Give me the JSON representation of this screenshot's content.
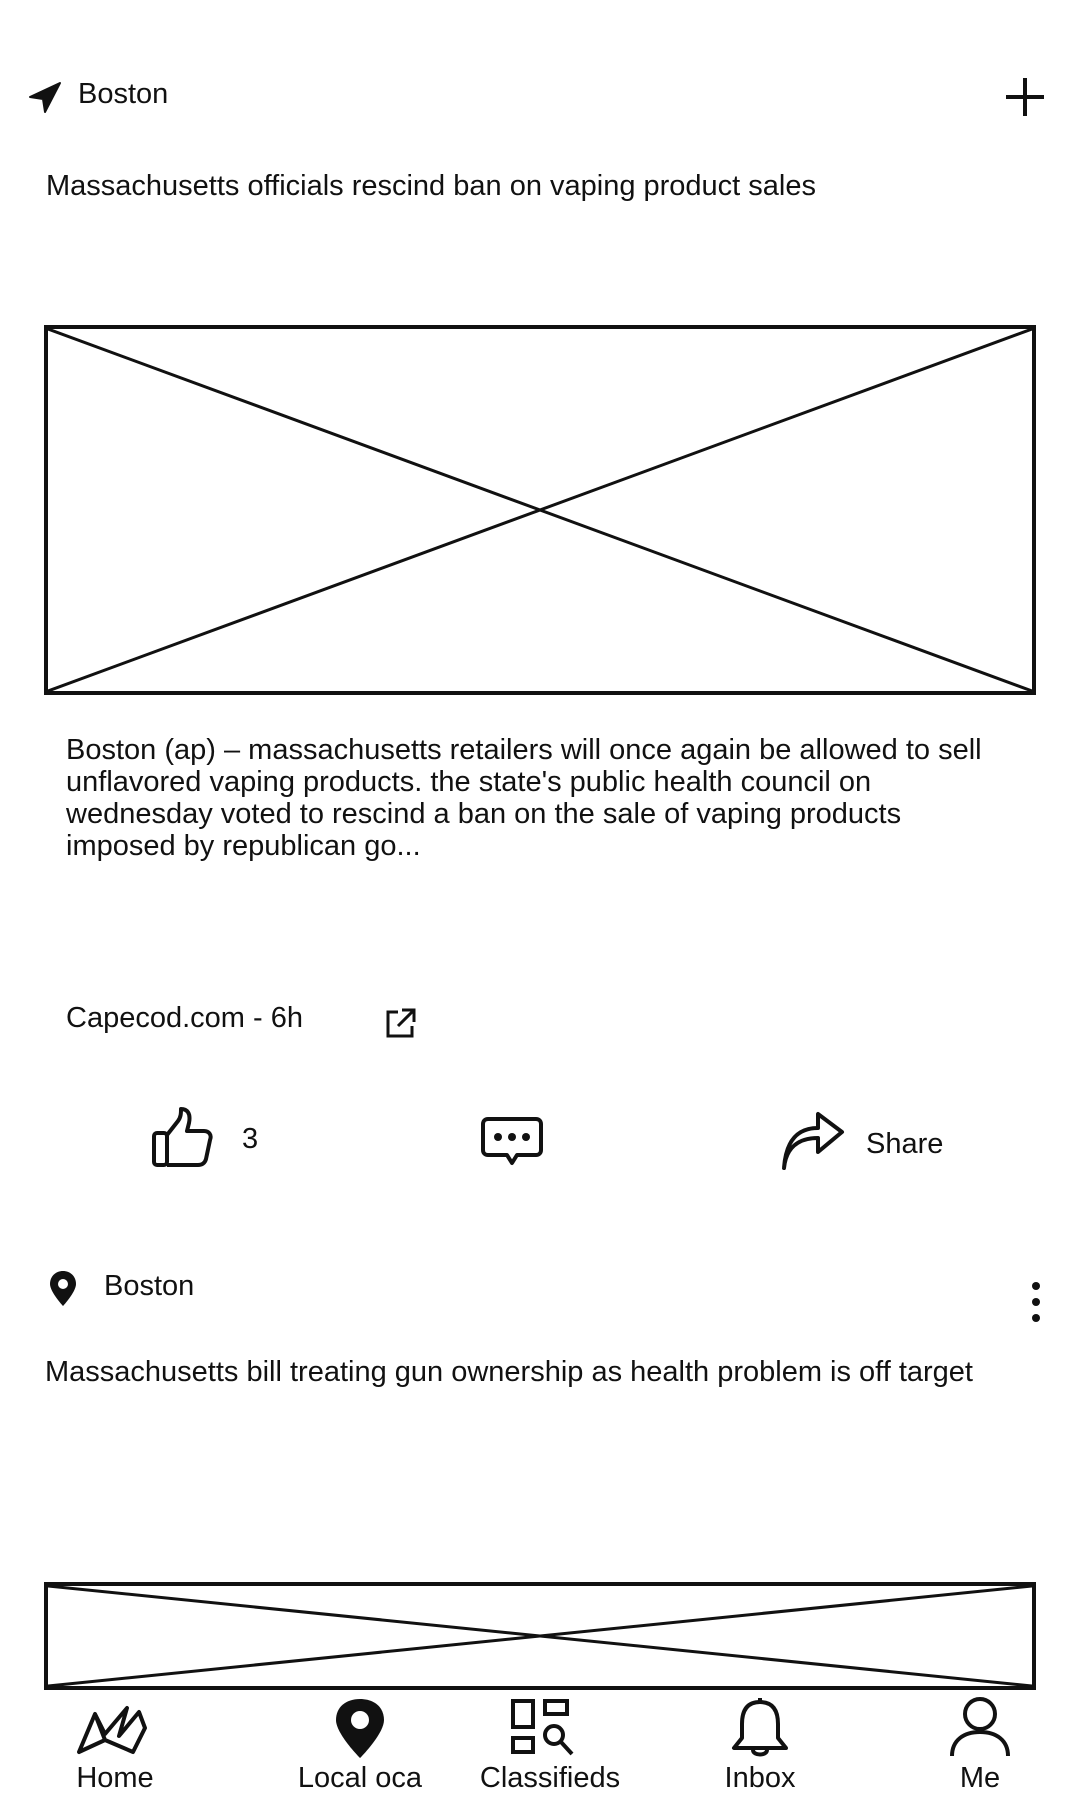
{
  "header": {
    "location": "Boston",
    "location_icon": "navigation-arrow-icon",
    "add_icon": "plus-icon"
  },
  "post1": {
    "title": "Massachusetts officials rescind ban on vaping product sales",
    "image_icon": "image-placeholder-icon",
    "summary": "Boston (ap) – massachusetts retailers will once again be allowed to sell unflavored vaping products. the state's public health council on wednesday voted to rescind a ban on the sale of vaping products imposed by republican go...",
    "source": "Capecod.com - 6h",
    "external_icon": "external-link-icon",
    "like_count": "3",
    "share_label": "Share"
  },
  "post2": {
    "location": "Boston",
    "location_icon": "map-pin-icon",
    "more_icon": "more-vertical-icon",
    "title": "Massachusetts bill treating gun ownership as health problem is off target",
    "image_icon": "image-placeholder-icon"
  },
  "bottom_nav": {
    "items": [
      {
        "label": "Home",
        "icon": "home-icon"
      },
      {
        "label": "Local oca",
        "icon": "map-pin-icon"
      },
      {
        "label": "Classifieds",
        "icon": "classifieds-icon"
      },
      {
        "label": "Inbox",
        "icon": "bell-icon"
      },
      {
        "label": "Me",
        "icon": "user-icon"
      }
    ]
  }
}
